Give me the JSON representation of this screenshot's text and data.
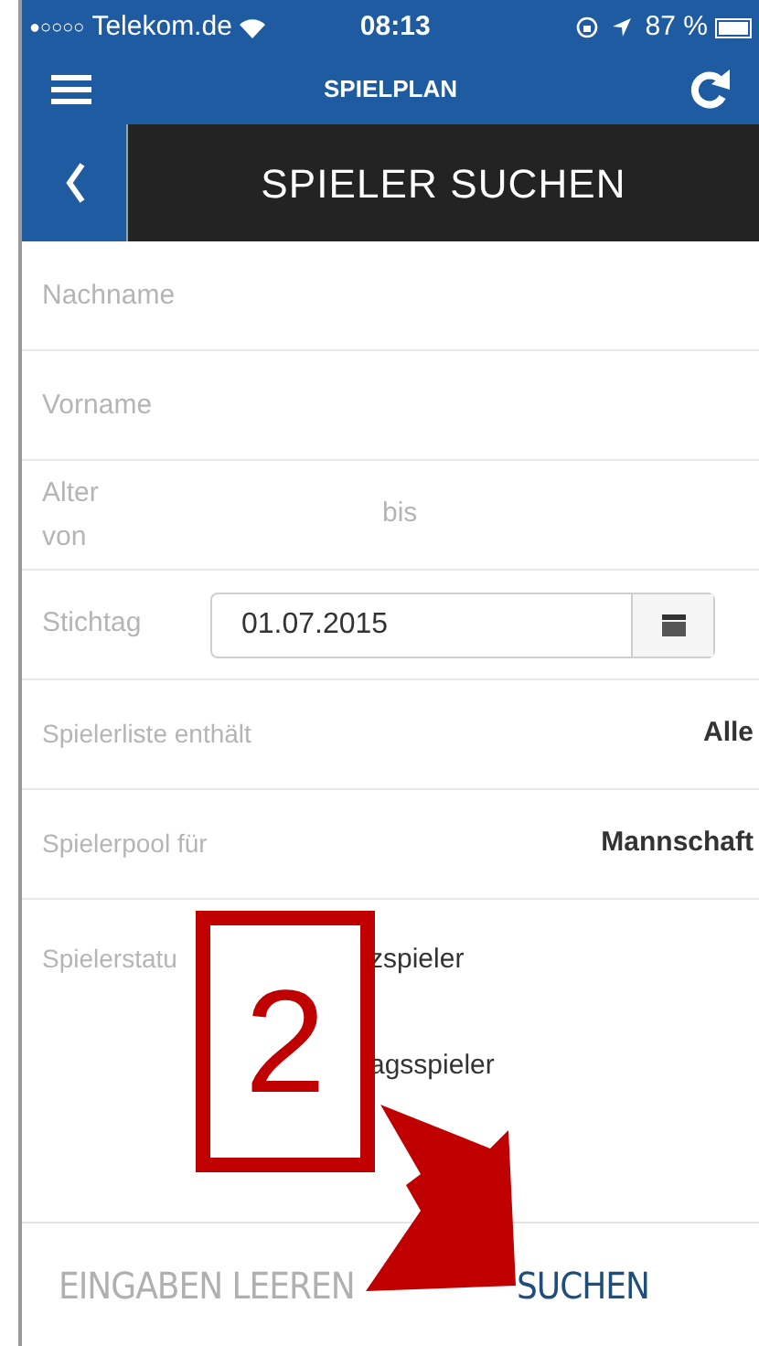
{
  "status_bar": {
    "signal": "●○○○○",
    "carrier": "Telekom.de",
    "time": "08:13",
    "battery": "87 %"
  },
  "nav_bar": {
    "title": "SPIELPLAN"
  },
  "header": {
    "title": "SPIELER SUCHEN"
  },
  "form": {
    "fields": [
      {
        "kind": "text",
        "placeholder": "Nachname"
      },
      {
        "kind": "text",
        "placeholder": "Vorname"
      },
      {
        "kind": "range",
        "label": "Alter",
        "from_label": "von",
        "to_label": "bis"
      },
      {
        "kind": "date",
        "label": "Stichtag",
        "value": "01.07.2015"
      },
      {
        "kind": "select",
        "label": "Spielerliste enthält",
        "value": "Alle"
      },
      {
        "kind": "select",
        "label": "Spielerpool für",
        "value": "Mannschaft"
      },
      {
        "kind": "options",
        "label": "Spielerstatu",
        "options": [
          "zspieler",
          "agsspieler"
        ]
      }
    ]
  },
  "footer": {
    "buttons": [
      {
        "label": "EINGABEN LEEREN",
        "primary": false
      },
      {
        "label": "SUCHEN",
        "primary": true
      }
    ]
  },
  "annotation": {
    "number": "2"
  }
}
